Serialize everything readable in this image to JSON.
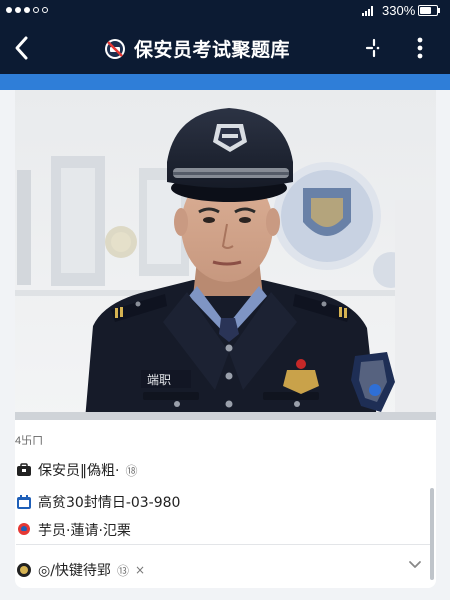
{
  "status_bar": {
    "battery_text": "330%",
    "battery_level": 0.8
  },
  "header": {
    "title": "保安员考试聚题库",
    "back_icon": "chevron-left-icon",
    "menu_icon": "more-vertical-icon",
    "action_icon": "split-arrows-icon"
  },
  "photo": {
    "badge_text": "端职"
  },
  "info": {
    "small_label": "4卐ㄇ",
    "line1": "保安员‖偽粗·",
    "line1_suffix": "⑱",
    "line2": "高贫30封情日-03-980",
    "line3": "芋员·蓮请·氾栗",
    "line4": "◎/快键待郢",
    "line4_suffix": "⑬",
    "line4_close": "×"
  },
  "colors": {
    "nav_bg": "#0c1b33",
    "accent_blue": "#2f7ed8",
    "card_bg": "#ffffff"
  }
}
